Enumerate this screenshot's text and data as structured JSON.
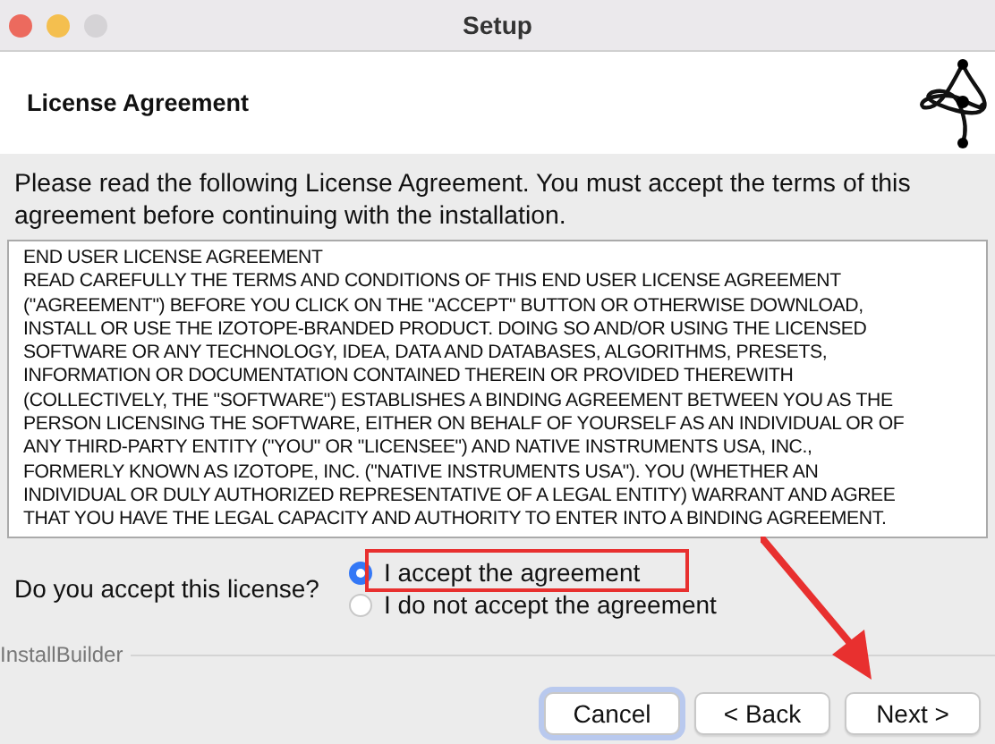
{
  "window": {
    "title": "Setup"
  },
  "header": {
    "title": "License Agreement"
  },
  "intro": "Please read the following License Agreement. You must accept the terms of this agreement before continuing with the installation.",
  "license_lines": [
    "END USER LICENSE AGREEMENT",
    "READ CAREFULLY THE TERMS AND CONDITIONS OF THIS END USER LICENSE AGREEMENT",
    "(\"AGREEMENT\") BEFORE YOU CLICK ON THE \"ACCEPT\" BUTTON OR OTHERWISE DOWNLOAD,",
    "INSTALL OR USE THE IZOTOPE-BRANDED PRODUCT. DOING SO AND/OR USING THE LICENSED",
    "SOFTWARE OR ANY TECHNOLOGY, IDEA, DATA AND DATABASES, ALGORITHMS, PRESETS,",
    "INFORMATION OR DOCUMENTATION CONTAINED THEREIN OR PROVIDED THEREWITH",
    "(COLLECTIVELY, THE \"SOFTWARE\") ESTABLISHES A BINDING AGREEMENT BETWEEN YOU AS THE",
    "PERSON LICENSING THE SOFTWARE, EITHER ON BEHALF OF YOURSELF AS AN INDIVIDUAL OR OF",
    "ANY THIRD-PARTY ENTITY (\"YOU\" OR \"LICENSEE\") AND NATIVE INSTRUMENTS USA, INC.,",
    "FORMERLY KNOWN AS IZOTOPE, INC. (\"NATIVE INSTRUMENTS USA\"). YOU (WHETHER AN",
    "INDIVIDUAL OR DULY AUTHORIZED REPRESENTATIVE OF A LEGAL ENTITY) WARRANT AND AGREE",
    "THAT YOU HAVE THE LEGAL CAPACITY AND AUTHORITY TO ENTER INTO A BINDING AGREEMENT."
  ],
  "question": "Do you accept this license?",
  "options": [
    {
      "label": "I accept the agreement",
      "selected": true
    },
    {
      "label": "I do not accept the agreement",
      "selected": false
    }
  ],
  "footer": {
    "brand": "InstallBuilder"
  },
  "buttons": [
    {
      "label": "Cancel",
      "kind": "focused"
    },
    {
      "label": "< Back",
      "kind": "normal"
    },
    {
      "label": "Next >",
      "kind": "normal"
    }
  ]
}
